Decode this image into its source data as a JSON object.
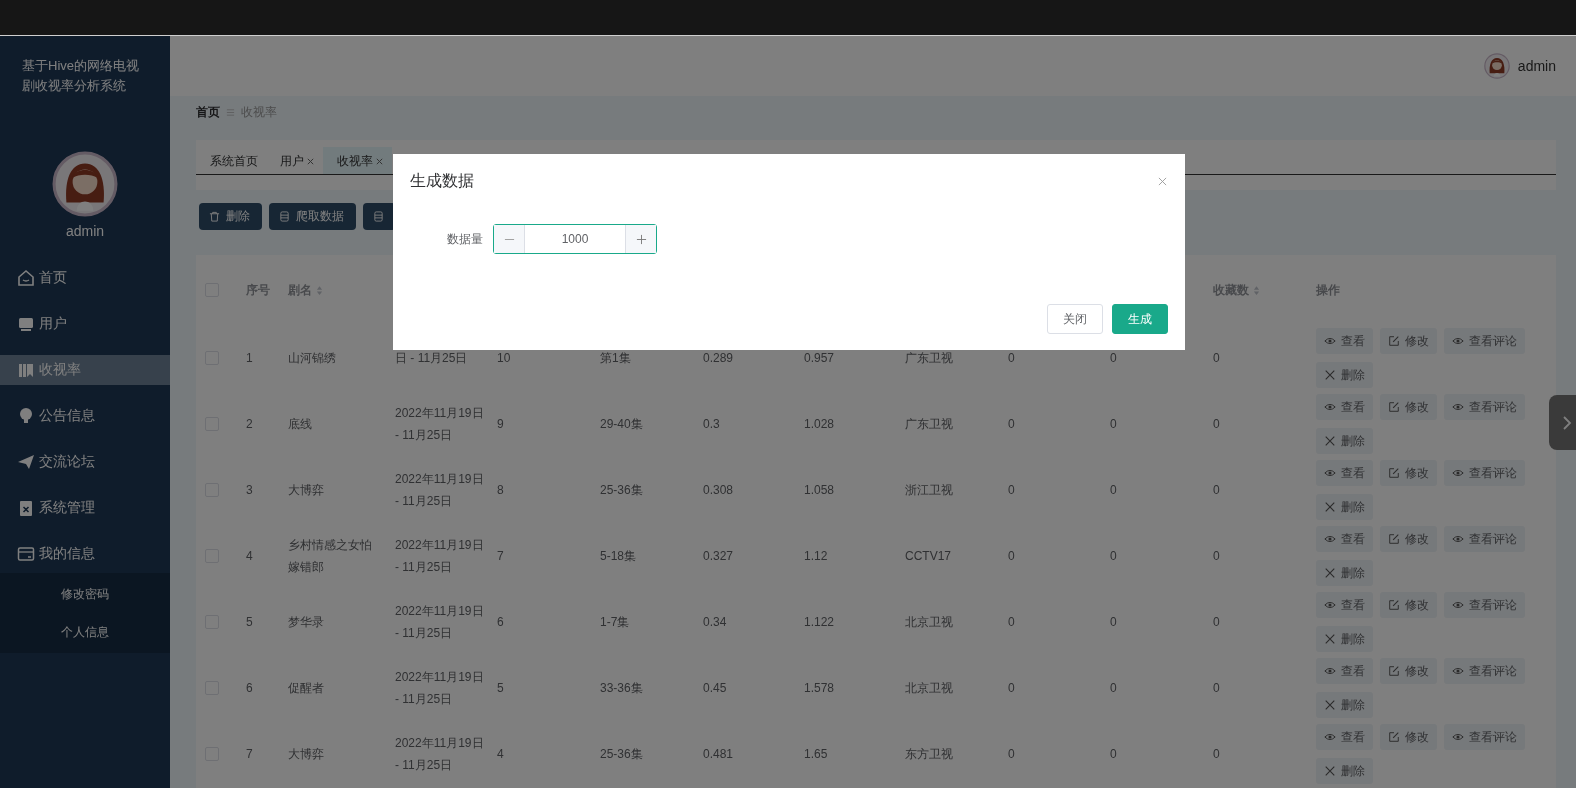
{
  "sidebar": {
    "title": "基于Hive的网络电视剧收视率分析系统",
    "user": "admin",
    "items": [
      {
        "label": "首页",
        "selected": false
      },
      {
        "label": "用户",
        "selected": false
      },
      {
        "label": "收视率",
        "selected": true
      },
      {
        "label": "公告信息",
        "selected": false
      },
      {
        "label": "交流论坛",
        "selected": false
      },
      {
        "label": "系统管理",
        "selected": false
      },
      {
        "label": "我的信息",
        "selected": false,
        "expanded": true,
        "children": [
          {
            "label": "修改密码"
          },
          {
            "label": "个人信息"
          }
        ]
      }
    ]
  },
  "header": {
    "user": "admin"
  },
  "breadcrumb": [
    "首页",
    "收视率"
  ],
  "tabs": [
    {
      "label": "系统首页",
      "selected": false,
      "closable": false
    },
    {
      "label": "用户",
      "selected": false,
      "closable": true
    },
    {
      "label": "收视率",
      "selected": true,
      "closable": true
    }
  ],
  "toolbar": [
    {
      "label": "删除",
      "kind": "delete"
    },
    {
      "label": "爬取数据",
      "kind": "data"
    },
    {
      "kind": "data"
    }
  ],
  "table": {
    "all_checked": false,
    "columns": [
      {
        "label": "序号",
        "sortable": false
      },
      {
        "label": "剧名",
        "sortable": true
      },
      null,
      null,
      null,
      null,
      null,
      null,
      null,
      null,
      {
        "label": "收藏数",
        "sortable": true
      },
      {
        "label": "操作",
        "sortable": false
      }
    ],
    "rows": [
      {
        "checked": false,
        "cells": [
          "1",
          "山河锦绣",
          "日 - 11月25日",
          "10",
          "第1集",
          "0.289",
          "0.957",
          "广东卫视",
          "0",
          "0",
          "0"
        ],
        "actions": [
          {
            "kind": "view",
            "label": "查看"
          },
          {
            "kind": "edit",
            "label": "修改"
          },
          {
            "kind": "view",
            "label": "查看评论"
          },
          {
            "kind": "delete",
            "label": "删除"
          }
        ]
      },
      {
        "checked": false,
        "cells": [
          "2",
          "底线",
          "2022年11月19日 - 11月25日",
          "9",
          "29-40集",
          "0.3",
          "1.028",
          "广东卫视",
          "0",
          "0",
          "0"
        ],
        "actions": [
          {
            "kind": "view",
            "label": "查看"
          },
          {
            "kind": "edit",
            "label": "修改"
          },
          {
            "kind": "view",
            "label": "查看评论"
          },
          {
            "kind": "delete",
            "label": "删除"
          }
        ]
      },
      {
        "checked": false,
        "cells": [
          "3",
          "大博弈",
          "2022年11月19日 - 11月25日",
          "8",
          "25-36集",
          "0.308",
          "1.058",
          "浙江卫视",
          "0",
          "0",
          "0"
        ],
        "actions": [
          {
            "kind": "view",
            "label": "查看"
          },
          {
            "kind": "edit",
            "label": "修改"
          },
          {
            "kind": "view",
            "label": "查看评论"
          },
          {
            "kind": "delete",
            "label": "删除"
          }
        ]
      },
      {
        "checked": false,
        "cells": [
          "4",
          "乡村情感之女怕嫁错郎",
          "2022年11月19日 - 11月25日",
          "7",
          "5-18集",
          "0.327",
          "1.12",
          "CCTV17",
          "0",
          "0",
          "0"
        ],
        "actions": [
          {
            "kind": "view",
            "label": "查看"
          },
          {
            "kind": "edit",
            "label": "修改"
          },
          {
            "kind": "view",
            "label": "查看评论"
          },
          {
            "kind": "delete",
            "label": "删除"
          }
        ]
      },
      {
        "checked": false,
        "cells": [
          "5",
          "梦华录",
          "2022年11月19日 - 11月25日",
          "6",
          "1-7集",
          "0.34",
          "1.122",
          "北京卫视",
          "0",
          "0",
          "0"
        ],
        "actions": [
          {
            "kind": "view",
            "label": "查看"
          },
          {
            "kind": "edit",
            "label": "修改"
          },
          {
            "kind": "view",
            "label": "查看评论"
          },
          {
            "kind": "delete",
            "label": "删除"
          }
        ]
      },
      {
        "checked": false,
        "cells": [
          "6",
          "促醒者",
          "2022年11月19日 - 11月25日",
          "5",
          "33-36集",
          "0.45",
          "1.578",
          "北京卫视",
          "0",
          "0",
          "0"
        ],
        "actions": [
          {
            "kind": "view",
            "label": "查看"
          },
          {
            "kind": "edit",
            "label": "修改"
          },
          {
            "kind": "view",
            "label": "查看评论"
          },
          {
            "kind": "delete",
            "label": "删除"
          }
        ]
      },
      {
        "checked": false,
        "cells": [
          "7",
          "大博弈",
          "2022年11月19日 - 11月25日",
          "4",
          "25-36集",
          "0.481",
          "1.65",
          "东方卫视",
          "0",
          "0",
          "0"
        ],
        "actions": [
          {
            "kind": "view",
            "label": "查看"
          },
          {
            "kind": "edit",
            "label": "修改"
          },
          {
            "kind": "view",
            "label": "查看评论"
          },
          {
            "kind": "delete",
            "label": "删除"
          }
        ]
      }
    ]
  },
  "dialog": {
    "title": "生成数据",
    "field_label": "数据量",
    "value": "1000",
    "buttons": [
      {
        "label": "关闭",
        "kind": "default"
      },
      {
        "label": "生成",
        "kind": "primary"
      }
    ]
  }
}
